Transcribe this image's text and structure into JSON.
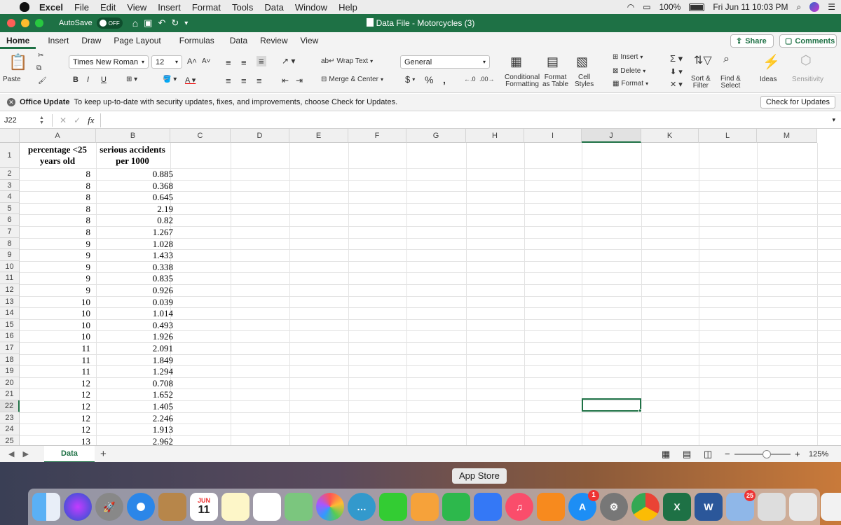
{
  "menubar": {
    "app": "Excel",
    "items": [
      "File",
      "Edit",
      "View",
      "Insert",
      "Format",
      "Tools",
      "Data",
      "Window",
      "Help"
    ],
    "battery": "100%",
    "datetime": "Fri Jun 11  10:03 PM"
  },
  "titlebar": {
    "autosave_label": "AutoSave",
    "autosave_state": "OFF",
    "document_title": "Data File - Motorcycles (3)"
  },
  "ribbon_tabs": [
    "Home",
    "Insert",
    "Draw",
    "Page Layout",
    "Formulas",
    "Data",
    "Review",
    "View"
  ],
  "share_label": "Share",
  "comments_label": "Comments",
  "ribbon": {
    "paste_label": "Paste",
    "font_name": "Times New Roman",
    "font_size": "12",
    "bold": "B",
    "italic": "I",
    "underline": "U",
    "wrap_text": "Wrap Text",
    "merge_center": "Merge & Center",
    "number_format": "General",
    "currency": "$",
    "percent": "%",
    "comma": ",",
    "conditional_formatting": [
      "Conditional",
      "Formatting"
    ],
    "format_as_table": [
      "Format",
      "as Table"
    ],
    "cell_styles": [
      "Cell",
      "Styles"
    ],
    "insert": "Insert",
    "delete": "Delete",
    "format": "Format",
    "sort_filter": [
      "Sort &",
      "Filter"
    ],
    "find_select": [
      "Find &",
      "Select"
    ],
    "ideas": "Ideas",
    "sensitivity": "Sensitivity"
  },
  "banner": {
    "title": "Office Update",
    "message": "To keep up-to-date with security updates, fixes, and improvements, choose Check for Updates.",
    "button": "Check for Updates"
  },
  "formula_bar": {
    "name_box": "J22",
    "fx": "fx",
    "value": ""
  },
  "columns": [
    "A",
    "B",
    "C",
    "D",
    "E",
    "F",
    "G",
    "H",
    "I",
    "J",
    "K",
    "L",
    "M"
  ],
  "selected_cell": "J22",
  "header_row": {
    "A": [
      "percentage <25",
      "years old"
    ],
    "B": [
      "serious accidents",
      "per 1000"
    ]
  },
  "rows": [
    {
      "r": "2",
      "a": "8",
      "b": "0.885"
    },
    {
      "r": "3",
      "a": "8",
      "b": "0.368"
    },
    {
      "r": "4",
      "a": "8",
      "b": "0.645"
    },
    {
      "r": "5",
      "a": "8",
      "b": "2.19"
    },
    {
      "r": "6",
      "a": "8",
      "b": "0.82"
    },
    {
      "r": "7",
      "a": "8",
      "b": "1.267"
    },
    {
      "r": "8",
      "a": "9",
      "b": "1.028"
    },
    {
      "r": "9",
      "a": "9",
      "b": "1.433"
    },
    {
      "r": "10",
      "a": "9",
      "b": "0.338"
    },
    {
      "r": "11",
      "a": "9",
      "b": "0.835"
    },
    {
      "r": "12",
      "a": "9",
      "b": "0.926"
    },
    {
      "r": "13",
      "a": "10",
      "b": "0.039"
    },
    {
      "r": "14",
      "a": "10",
      "b": "1.014"
    },
    {
      "r": "15",
      "a": "10",
      "b": "0.493"
    },
    {
      "r": "16",
      "a": "10",
      "b": "1.926"
    },
    {
      "r": "17",
      "a": "11",
      "b": "2.091"
    },
    {
      "r": "18",
      "a": "11",
      "b": "1.849"
    },
    {
      "r": "19",
      "a": "11",
      "b": "1.294"
    },
    {
      "r": "20",
      "a": "12",
      "b": "0.708"
    },
    {
      "r": "21",
      "a": "12",
      "b": "1.652"
    },
    {
      "r": "22",
      "a": "12",
      "b": "1.405"
    },
    {
      "r": "23",
      "a": "12",
      "b": "2.246"
    },
    {
      "r": "24",
      "a": "12",
      "b": "1.913"
    },
    {
      "r": "25",
      "a": "13",
      "b": "2.962"
    }
  ],
  "sheet_tab": "Data",
  "add_sheet": "+",
  "zoom": "125%",
  "dock_tooltip": "App Store",
  "dock_calendar": {
    "month": "JUN",
    "day": "11"
  },
  "dock_badges": {
    "app_store": "1",
    "photos_date": "25"
  },
  "dock_apps": [
    "Finder",
    "Siri",
    "Launchpad",
    "Safari",
    "Contacts",
    "Calendar",
    "Notes",
    "Reminders",
    "Maps",
    "Photos",
    "Messages",
    "FaceTime",
    "Pages",
    "Numbers",
    "Keynote",
    "Music",
    "Books",
    "App Store",
    "System Preferences",
    "Chrome",
    "Excel",
    "Word",
    "Preview",
    "Downloads",
    "Trash"
  ],
  "colors": {
    "excel_green": "#1e7145",
    "selection": "#1e7145"
  }
}
